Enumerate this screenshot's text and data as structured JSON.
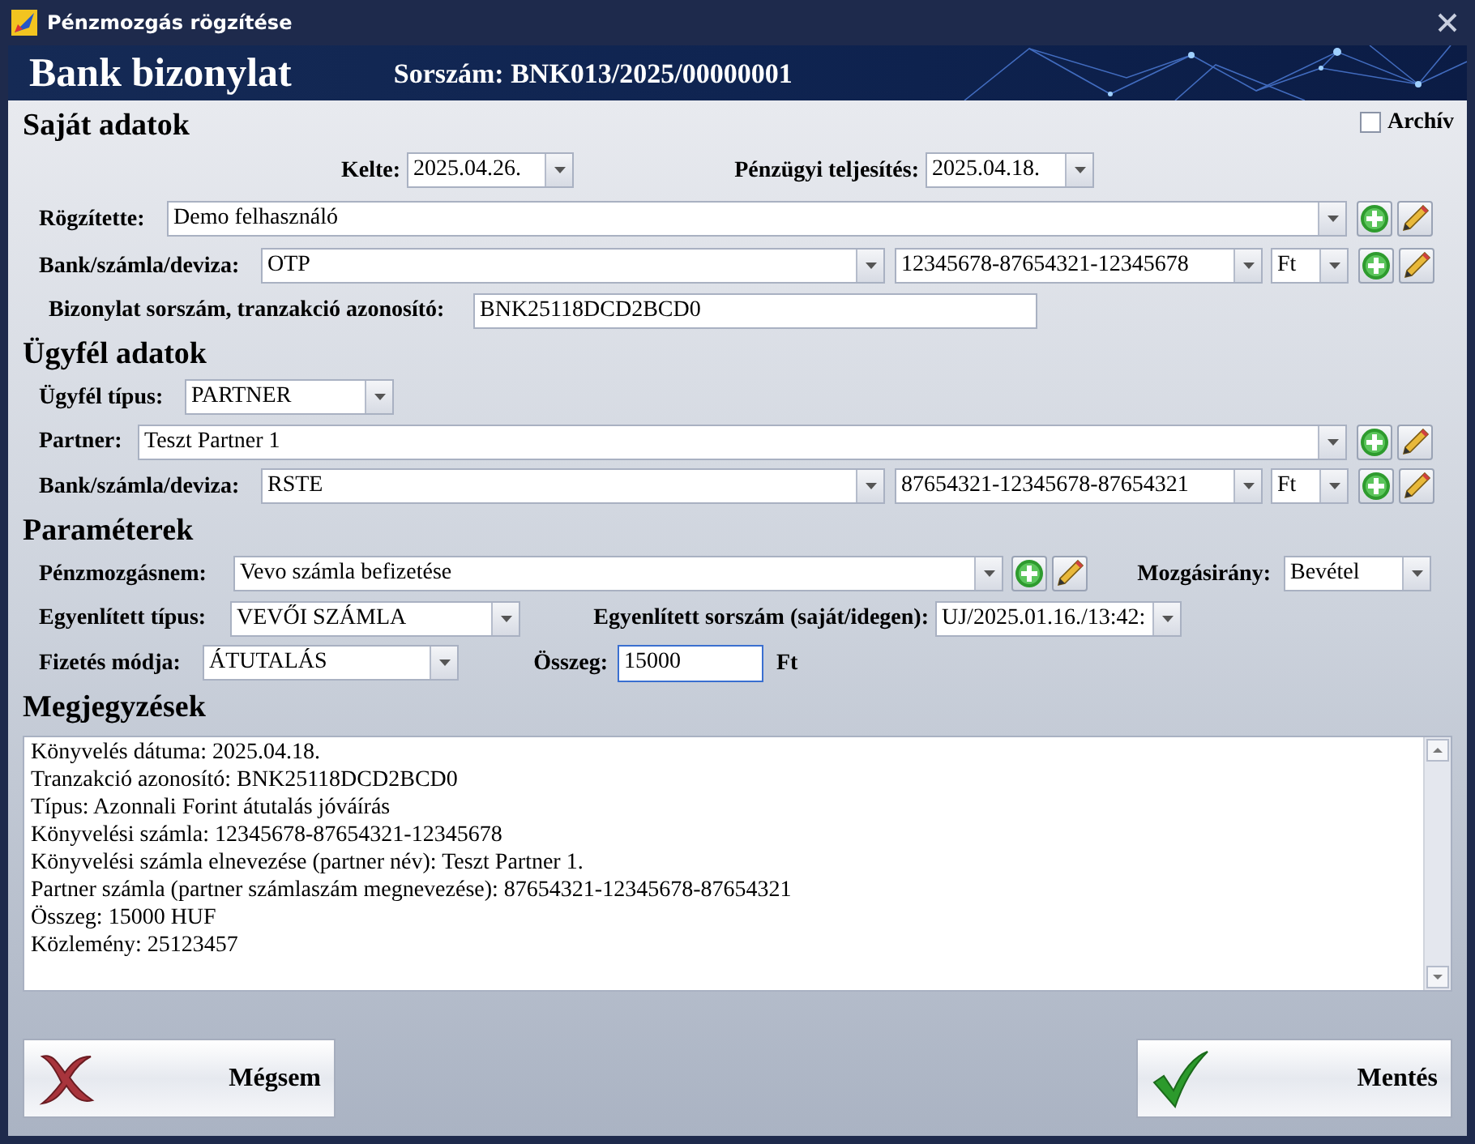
{
  "window": {
    "title": "Pénzmozgás rögzítése"
  },
  "header": {
    "title": "Bank bizonylat",
    "serial": "Sorszám: BNK013/2025/00000001"
  },
  "archive": {
    "label": "Archív",
    "checked": false
  },
  "own": {
    "heading": "Saját adatok",
    "date": {
      "label": "Kelte:",
      "value": "2025.04.26."
    },
    "settlement": {
      "label": "Pénzügyi teljesítés:",
      "value": "2025.04.18."
    },
    "recorded_by": {
      "label": "Rögzítette:",
      "value": "Demo felhasználó"
    },
    "bank": {
      "label": "Bank/számla/deviza:",
      "bank": "OTP",
      "account": "12345678-87654321-12345678",
      "currency": "Ft"
    },
    "reference": {
      "label": "Bizonylat sorszám, tranzakció azonosító:",
      "value": "BNK25118DCD2BCD0"
    }
  },
  "client": {
    "heading": "Ügyfél adatok",
    "type": {
      "label": "Ügyfél típus:",
      "value": "PARTNER"
    },
    "partner": {
      "label": "Partner:",
      "value": "Teszt Partner 1"
    },
    "bank": {
      "label": "Bank/számla/deviza:",
      "bank": "RSTE",
      "account": "87654321-12345678-87654321",
      "currency": "Ft"
    }
  },
  "params": {
    "heading": "Paraméterek",
    "movement_type": {
      "label": "Pénzmozgásnem:",
      "value": "Vevo számla befizetése"
    },
    "direction": {
      "label": "Mozgásirány:",
      "value": "Bevétel"
    },
    "settled_type": {
      "label": "Egyenlített típus:",
      "value": "VEVŐI SZÁMLA"
    },
    "settled_number": {
      "label": "Egyenlített sorszám (saját/idegen):",
      "value": "UJ/2025.01.16./13:42:"
    },
    "payment_method": {
      "label": "Fizetés módja:",
      "value": "ÁTUTALÁS"
    },
    "amount": {
      "label": "Összeg:",
      "value": "15000",
      "unit": "Ft"
    }
  },
  "notes": {
    "heading": "Megjegyzések",
    "lines": [
      "Könyvelés dátuma: 2025.04.18.",
      "Tranzakció azonosító: BNK25118DCD2BCD0",
      "Típus: Azonnali Forint átutalás jóváírás",
      "Könyvelési számla: 12345678-87654321-12345678",
      "Könyvelési számla elnevezése (partner név): Teszt Partner 1.",
      "Partner számla (partner számlaszám megnevezése): 87654321-12345678-87654321",
      "Összeg: 15000 HUF",
      "Közlemény: 25123457"
    ]
  },
  "buttons": [
    {
      "label": "Mégsem",
      "kind": "cancel"
    },
    {
      "label": "Mentés",
      "kind": "save"
    }
  ]
}
